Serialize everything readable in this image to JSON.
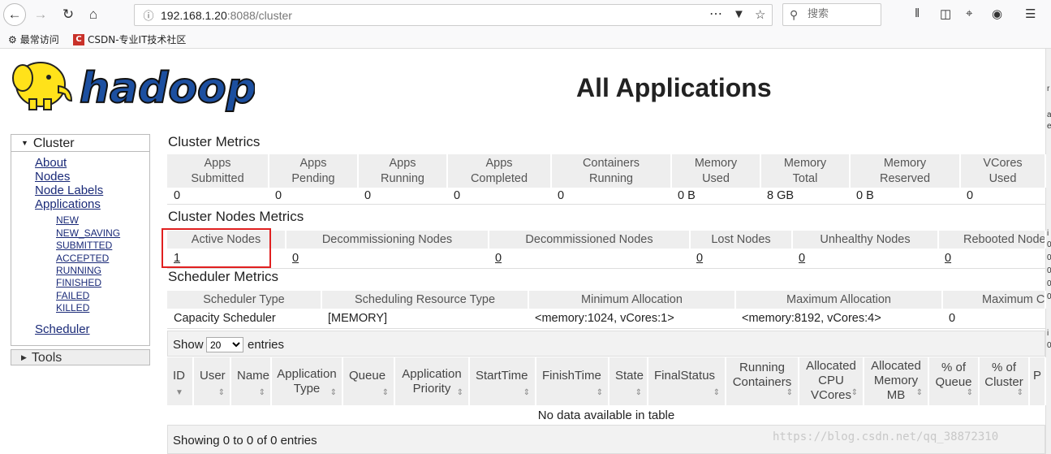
{
  "browser": {
    "url_host": "192.168.1.20",
    "url_rest": ":8088/cluster",
    "search_placeholder": "搜索",
    "bookmarks": [
      {
        "label": "最常访问"
      },
      {
        "label": "CSDN-专业IT技术社区"
      }
    ],
    "csdn_icon_text": "C",
    "overflow_text": [
      "r",
      "a",
      "e",
      "i",
      "0",
      "0",
      "0",
      "0",
      "0",
      "i",
      "0"
    ],
    "colors": {
      "chrome_bg": "#f9f9fa",
      "highlight": "#e02020"
    }
  },
  "page": {
    "logo_text": "hadoop",
    "title": "All Applications",
    "nav": {
      "cluster_label": "Cluster",
      "cluster_links": [
        "About",
        "Nodes",
        "Node Labels",
        "Applications"
      ],
      "app_states": [
        "NEW",
        "NEW_SAVING",
        "SUBMITTED",
        "ACCEPTED",
        "RUNNING",
        "FINISHED",
        "FAILED",
        "KILLED"
      ],
      "scheduler_label": "Scheduler",
      "tools_label": "Tools",
      "link_color": "#1a2a78"
    },
    "cluster_metrics": {
      "title": "Cluster Metrics",
      "headers": [
        [
          "Apps",
          "Submitted"
        ],
        [
          "Apps",
          "Pending"
        ],
        [
          "Apps",
          "Running"
        ],
        [
          "Apps",
          "Completed"
        ],
        [
          "Containers",
          "Running"
        ],
        [
          "Memory",
          "Used"
        ],
        [
          "Memory",
          "Total"
        ],
        [
          "Memory",
          "Reserved"
        ],
        [
          "VCores",
          "Used"
        ]
      ],
      "values": [
        "0",
        "0",
        "0",
        "0",
        "0",
        "0 B",
        "8 GB",
        "0 B",
        "0"
      ]
    },
    "nodes_metrics": {
      "title": "Cluster Nodes Metrics",
      "headers": [
        "Active Nodes",
        "Decommissioning Nodes",
        "Decommissioned Nodes",
        "Lost Nodes",
        "Unhealthy Nodes",
        "Rebooted Nodes"
      ],
      "values": [
        "1",
        "0",
        "0",
        "0",
        "0",
        "0"
      ]
    },
    "scheduler_metrics": {
      "title": "Scheduler Metrics",
      "headers": [
        "Scheduler Type",
        "Scheduling Resource Type",
        "Minimum Allocation",
        "Maximum Allocation",
        "Maximum C"
      ],
      "values": [
        "Capacity Scheduler",
        "[MEMORY]",
        "<memory:1024, vCores:1>",
        "<memory:8192, vCores:4>",
        "0"
      ]
    },
    "apps_table": {
      "show_label": "Show",
      "entries_label": "entries",
      "page_size": "20",
      "columns": [
        [
          "ID"
        ],
        [
          "User"
        ],
        [
          "Name"
        ],
        [
          "Application",
          "Type"
        ],
        [
          "Queue"
        ],
        [
          "Application",
          "Priority"
        ],
        [
          "StartTime"
        ],
        [
          "FinishTime"
        ],
        [
          "State"
        ],
        [
          "FinalStatus"
        ],
        [
          "Running",
          "Containers"
        ],
        [
          "Allocated",
          "CPU",
          "VCores"
        ],
        [
          "Allocated",
          "Memory",
          "MB"
        ],
        [
          "% of",
          "Queue"
        ],
        [
          "% of",
          "Cluster"
        ],
        [
          "P"
        ]
      ],
      "empty_text": "No data available in table",
      "footer_text": "Showing 0 to 0 of 0 entries"
    },
    "watermark": "https://blog.csdn.net/qq_38872310"
  }
}
